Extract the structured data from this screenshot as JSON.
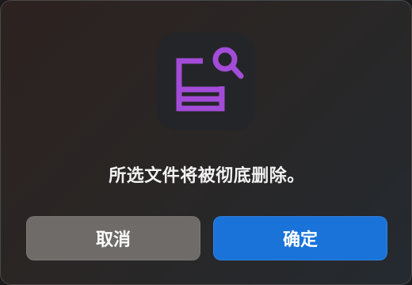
{
  "dialog": {
    "icon": "file-search-icon",
    "icon_color": "#a34cd9",
    "message": "所选文件将被彻底删除。",
    "cancel_label": "取消",
    "confirm_label": "确定",
    "confirm_color": "#1a73d9",
    "cancel_color": "#6e6b69"
  }
}
